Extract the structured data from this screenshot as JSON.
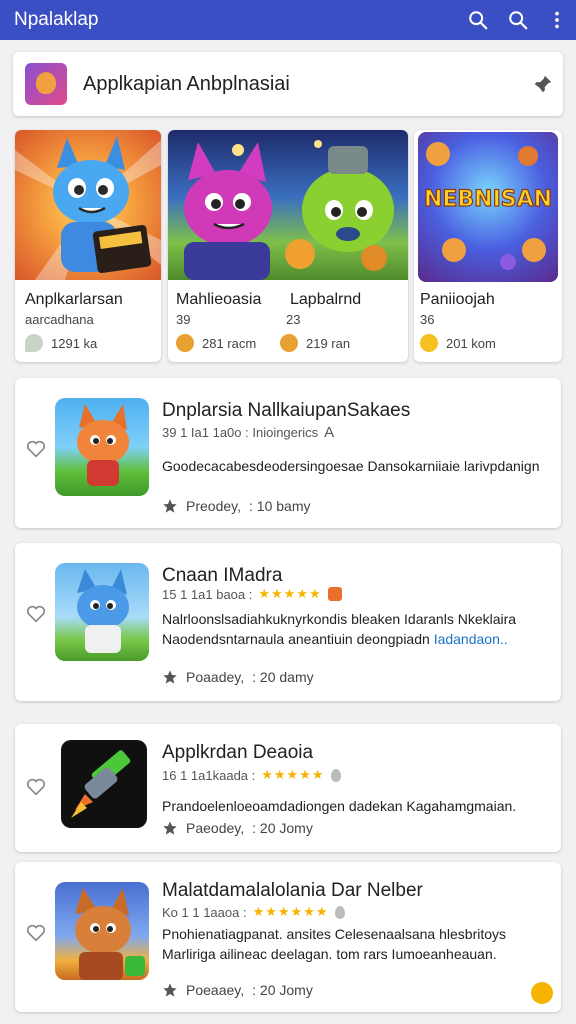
{
  "appbar": {
    "title": "Npalaklap",
    "icons": [
      "search-icon",
      "search-icon",
      "more-vert-icon"
    ],
    "color": "#3b4fc4"
  },
  "banner": {
    "title": "Applkapian Anbplnasiai",
    "pin_icon": "pin-icon"
  },
  "featured": [
    {
      "name": "Anplkarlarsan",
      "sub": "aarcadhana",
      "meta": "1291 ka",
      "meta_icon": "chat-icon"
    },
    {
      "name": "Mahlieoasia",
      "sub": "39",
      "meta": "281 racm",
      "meta_icon": "coin-icon"
    },
    {
      "name": "Lapbalrnd",
      "sub": "23",
      "meta": "219 ran",
      "meta_icon": "coin-icon"
    },
    {
      "name": "Paniioojah",
      "sub": "36",
      "meta": "201 kom",
      "meta_icon": "smile-icon",
      "art_text": "NEBNISAN"
    }
  ],
  "list": [
    {
      "name": "Dnplarsia NallkaiupanSakaes",
      "meta": "39 1 Ia1 1a0o : Inioingerics",
      "meta_suffix": "A",
      "desc": "Goodecacabesdeodersingoesae Dansokarniiaie larivpdanign",
      "desc_link": "",
      "foot_label": "Preodey,",
      "foot_value": ": 10 bamy"
    },
    {
      "name": "Cnaan IMadra",
      "meta": "15 1 1a1 baoa :",
      "stars": "★★★★★",
      "desc": "Nalrloonslsadiahkuknyrkondis bleaken Idaranls Nkeklaira Naodendsntarnaula aneantiuin deongpiadn",
      "desc_link": "Iadandaon..",
      "foot_label": "Poaadey,",
      "foot_value": ": 20 damy"
    },
    {
      "name": "Applkrdan Deaoia",
      "meta": "16 1 1a1kaada :",
      "stars": "★★★★★",
      "desc": "Prandoelenloeoamdadiongen dadekan Kagahamgmaian.",
      "desc_link": "",
      "foot_label": "Paeodey,",
      "foot_value": ": 20 Jomy"
    },
    {
      "name": "Malatdamalalolania Dar Nelber",
      "meta": "Ko 1 1 1aaoa :",
      "stars": "★★★★★★",
      "desc": "Pnohienatiagpanat. ansites Celesenaalsana hlesbritoys Marliriga ailineac deelagan. tom rars Iumoeanheauan.",
      "desc_link": "",
      "foot_label": "Poeaaey,",
      "foot_value": ": 20 Jomy"
    }
  ]
}
